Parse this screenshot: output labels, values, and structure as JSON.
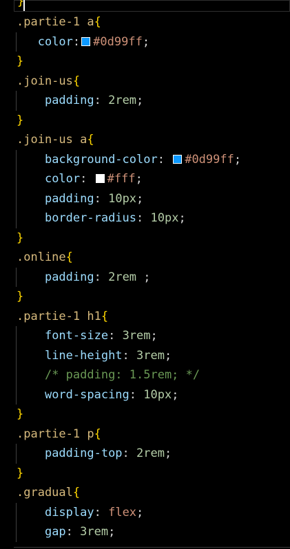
{
  "editor": {
    "top_brace": "}",
    "lines": [
      {
        "sel": ".partie-1 a",
        "open": "{"
      },
      {
        "prop": "color",
        "swatch": "#0d99ff",
        "value": "#0d99ff",
        "value_type": "str",
        "end": ";"
      },
      {
        "close": "}"
      },
      {
        "sel": ".join-us",
        "open": "{"
      },
      {
        "prop": "padding",
        "value": "2rem",
        "value_type": "num",
        "end": ";"
      },
      {
        "close": "}"
      },
      {
        "sel": ".join-us a",
        "open": "{"
      },
      {
        "prop": "background-color",
        "swatch": "#0d99ff",
        "value": "#0d99ff",
        "value_type": "str",
        "end": ";"
      },
      {
        "prop": "color",
        "swatch": "#ffffff",
        "value": "#fff",
        "value_type": "str",
        "end": ";"
      },
      {
        "prop": "padding",
        "value": "10px",
        "value_type": "num",
        "end": ";"
      },
      {
        "prop": "border-radius",
        "value": "10px",
        "value_type": "num",
        "end": ";"
      },
      {
        "close": "}"
      },
      {
        "sel": ".online",
        "open": "{"
      },
      {
        "prop": "padding",
        "value": "2rem",
        "value_type": "num",
        "end": " ;"
      },
      {
        "close": "}"
      },
      {
        "sel": ".partie-1 h1",
        "open": "{"
      },
      {
        "prop": "font-size",
        "value": "3rem",
        "value_type": "num",
        "end": ";"
      },
      {
        "prop": "line-height",
        "value": "3rem",
        "value_type": "num",
        "end": ";"
      },
      {
        "comment": "/* padding: 1.5rem; */"
      },
      {
        "prop": "word-spacing",
        "value": "10px",
        "value_type": "num",
        "end": ";"
      },
      {
        "close": "}"
      },
      {
        "sel": ".partie-1 p",
        "open": "{"
      },
      {
        "prop": "padding-top",
        "value": "2rem",
        "value_type": "num",
        "end": ";"
      },
      {
        "close": "}"
      },
      {
        "sel": ".gradual",
        "open": "{"
      },
      {
        "prop": "display",
        "value": "flex",
        "value_type": "str",
        "end": ";"
      },
      {
        "prop": "gap",
        "value": "3rem",
        "value_type": "num",
        "end": ";"
      }
    ]
  },
  "colors": {
    "selector": "#d7ba7d",
    "brace": "#ffd700",
    "property": "#9cdcfe",
    "number": "#b5cea8",
    "string": "#ce9178",
    "comment": "#6a9955",
    "background": "#000000"
  }
}
